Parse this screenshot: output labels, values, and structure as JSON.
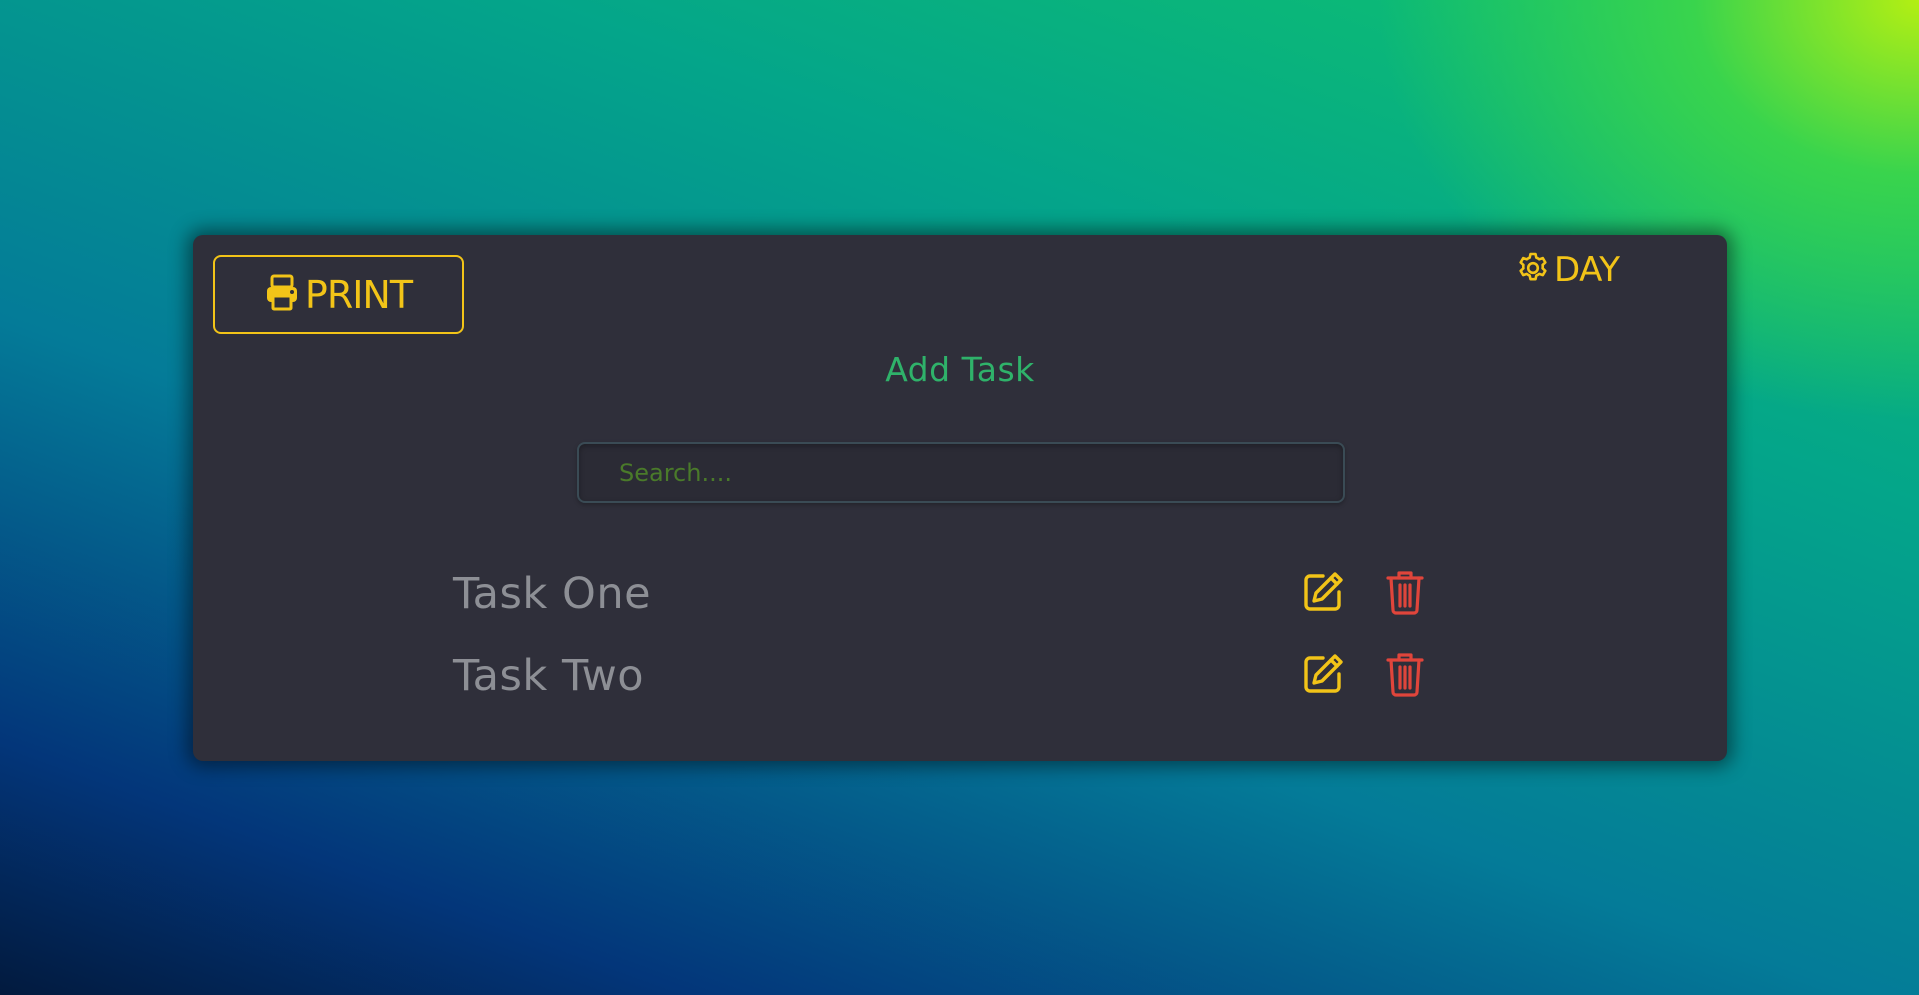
{
  "header": {
    "print_label": "PRINT",
    "theme_label": "DAY"
  },
  "main": {
    "add_task_label": "Add Task",
    "search": {
      "placeholder": "Search....",
      "value": ""
    },
    "tasks": [
      {
        "name": "Task One"
      },
      {
        "name": "Task Two"
      }
    ]
  },
  "icons": {
    "print": "printer-icon",
    "theme": "gear-icon",
    "edit": "edit-icon",
    "delete": "trash-icon"
  },
  "colors": {
    "accent_yellow": "#f2c418",
    "add_task_green": "#2fb26a",
    "delete_red": "#e0453b",
    "card_background": "#2f2f3a",
    "task_text": "#8d8f95"
  }
}
